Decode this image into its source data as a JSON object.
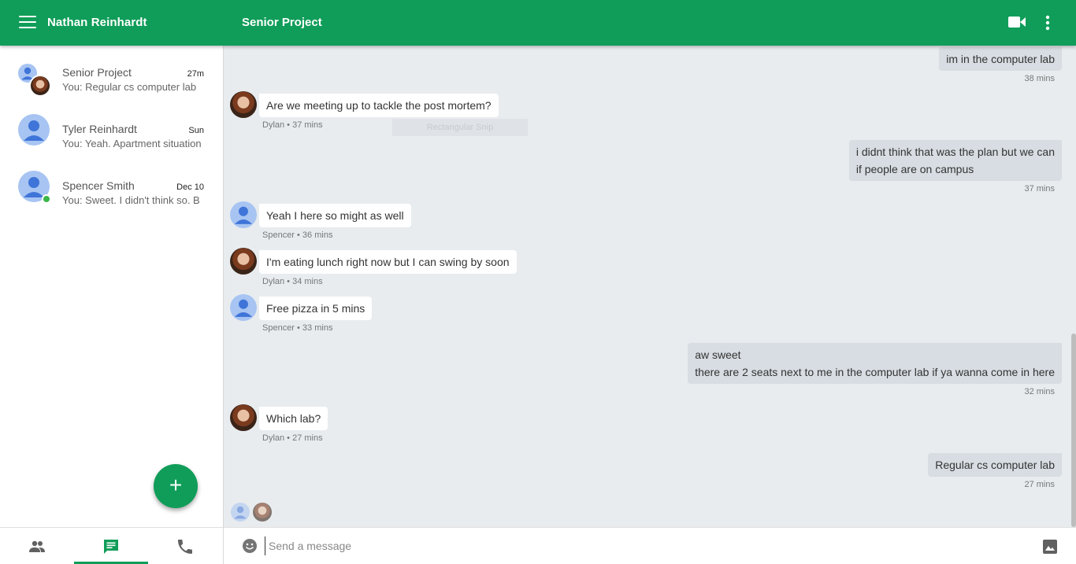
{
  "header": {
    "user_name": "Nathan Reinhardt",
    "conversation_title": "Senior Project",
    "brand_color": "#109d59"
  },
  "conversations": [
    {
      "name": "Senior Project",
      "time": "27m",
      "snippet": "You: Regular cs computer lab",
      "avatar": "group"
    },
    {
      "name": "Tyler Reinhardt",
      "time": "Sun",
      "snippet": "You: Yeah. Apartment situation",
      "avatar": "person"
    },
    {
      "name": "Spencer Smith",
      "time": "Dec 10",
      "snippet": "You: Sweet. I didn't think so. B",
      "avatar": "person-online"
    }
  ],
  "nav_tabs": [
    {
      "name": "contacts",
      "icon": "people-icon",
      "active": false
    },
    {
      "name": "messages",
      "icon": "chat-icon",
      "active": true
    },
    {
      "name": "calls",
      "icon": "phone-icon",
      "active": false
    }
  ],
  "messages": [
    {
      "direction": "out",
      "lines": [
        "im in the computer lab"
      ],
      "meta": "38 mins"
    },
    {
      "direction": "in",
      "sender_avatar": "photo",
      "lines": [
        "Are we meeting up to tackle the post mortem?"
      ],
      "meta": "Dylan • 37 mins"
    },
    {
      "direction": "out",
      "lines": [
        "i didnt think that was the plan but we can",
        "if people are on campus"
      ],
      "meta": "37 mins"
    },
    {
      "direction": "in",
      "sender_avatar": "person",
      "lines": [
        "Yeah I here so might as well"
      ],
      "meta": "Spencer • 36 mins"
    },
    {
      "direction": "in",
      "sender_avatar": "photo",
      "lines": [
        "I'm eating lunch right now but I can swing by soon"
      ],
      "meta": "Dylan • 34 mins"
    },
    {
      "direction": "in",
      "sender_avatar": "person",
      "lines": [
        "Free pizza in 5 mins"
      ],
      "meta": "Spencer • 33 mins"
    },
    {
      "direction": "out",
      "lines": [
        "aw sweet",
        "there are 2 seats next to me in the computer lab if ya wanna come in here"
      ],
      "meta": "32 mins"
    },
    {
      "direction": "in",
      "sender_avatar": "photo",
      "lines": [
        "Which lab?"
      ],
      "meta": "Dylan • 27 mins"
    },
    {
      "direction": "out",
      "lines": [
        "Regular cs computer lab"
      ],
      "meta": "27 mins"
    }
  ],
  "overlay_text": "Rectangular Snip",
  "composer": {
    "placeholder": "Send a message"
  }
}
